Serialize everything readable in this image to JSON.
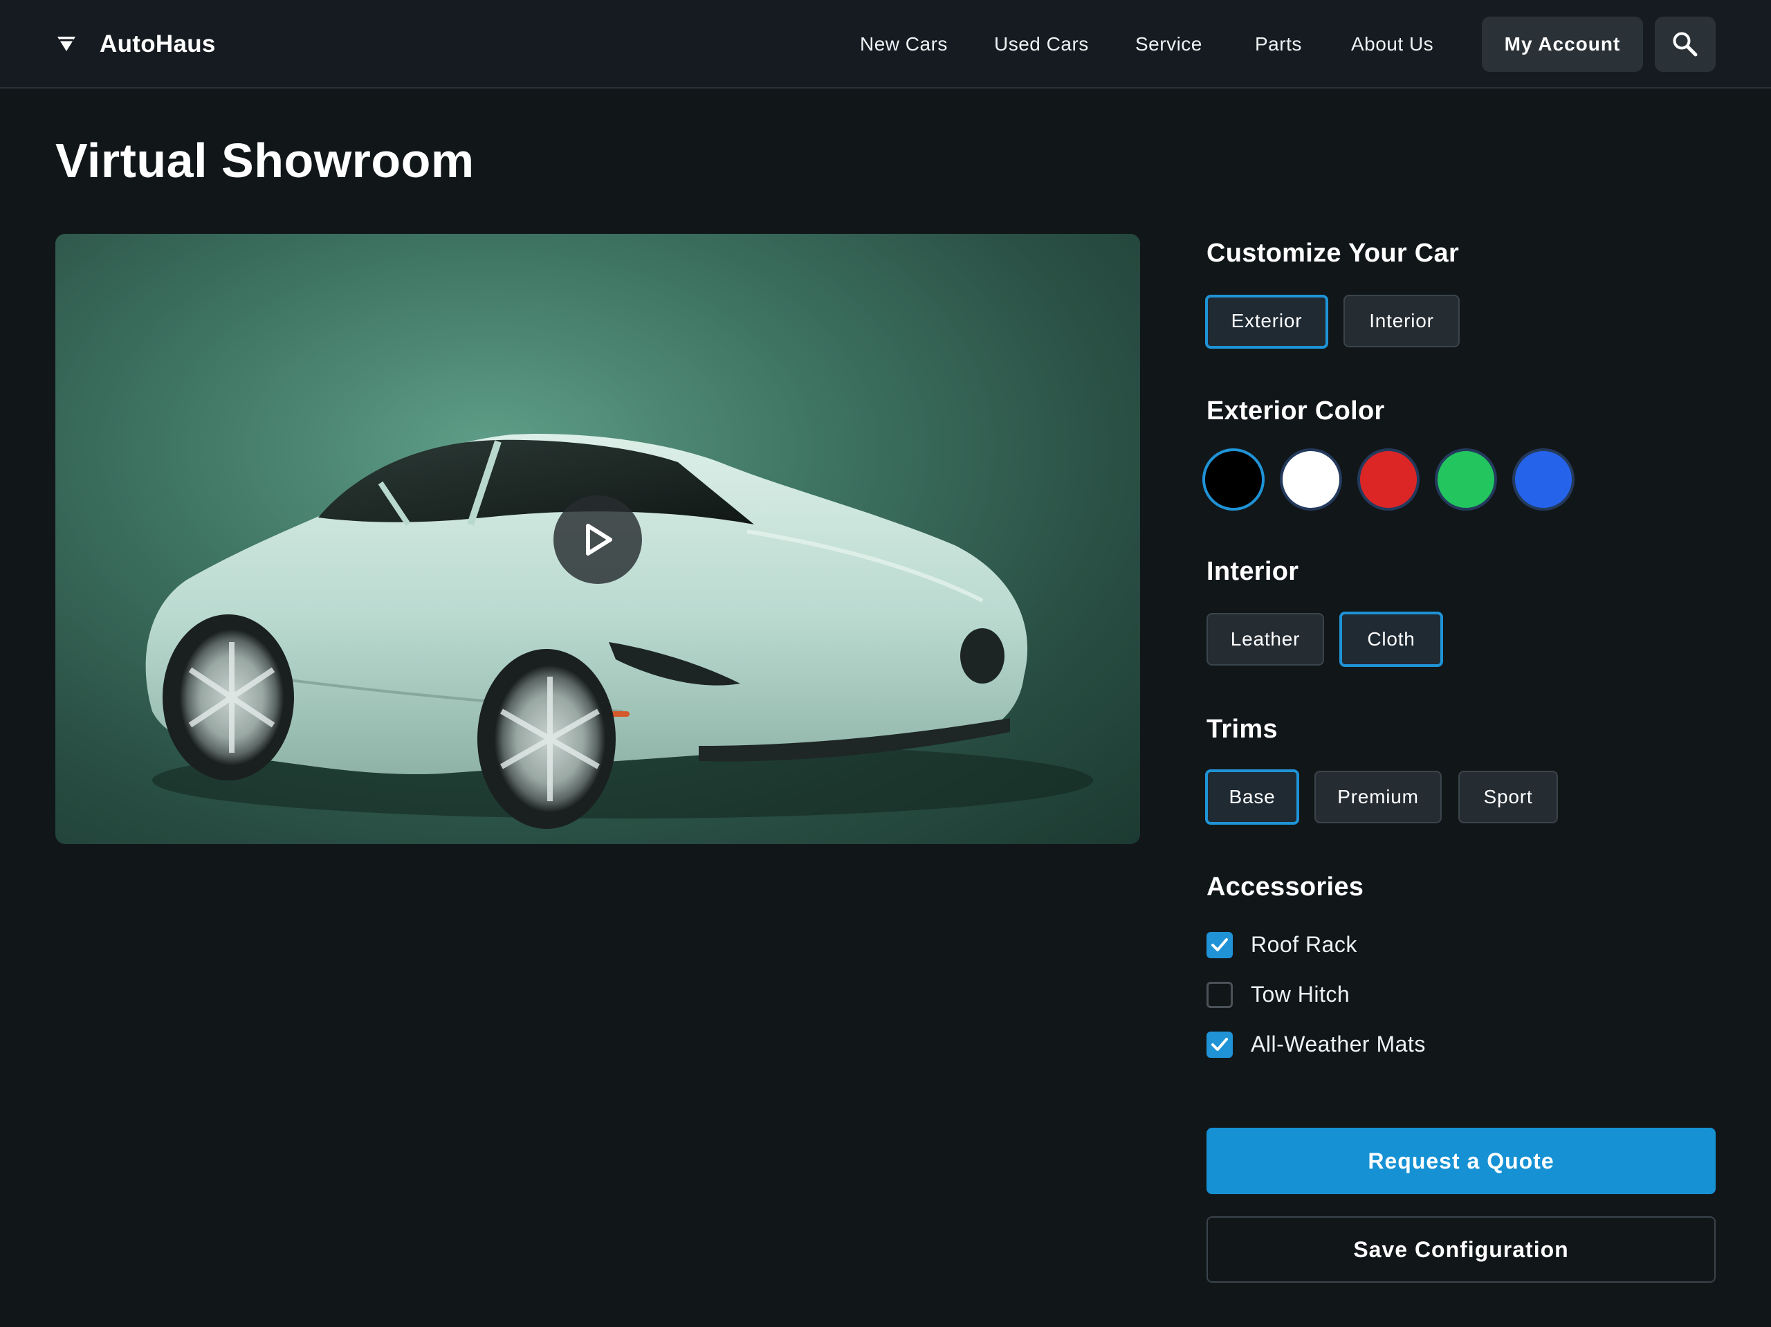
{
  "header": {
    "brand": "AutoHaus",
    "logo_icon": "diamond-cone-icon",
    "nav": [
      "New Cars",
      "Used Cars",
      "Service",
      "Parts",
      "About Us"
    ],
    "account_label": "My Account",
    "search_icon": "search-icon"
  },
  "page_title": "Virtual Showroom",
  "viewer": {
    "play_icon": "play-icon",
    "car_color": "#b9d9cf"
  },
  "customize": {
    "title": "Customize Your Car",
    "tabs": [
      {
        "label": "Exterior",
        "selected": true
      },
      {
        "label": "Interior",
        "selected": false
      }
    ]
  },
  "exterior_color": {
    "title": "Exterior Color",
    "swatches": [
      {
        "name": "black",
        "color": "#000000",
        "selected": true
      },
      {
        "name": "white",
        "color": "#ffffff",
        "selected": false
      },
      {
        "name": "red",
        "color": "#dc2626",
        "selected": false
      },
      {
        "name": "green",
        "color": "#22c55e",
        "selected": false
      },
      {
        "name": "blue",
        "color": "#2563eb",
        "selected": false
      }
    ]
  },
  "interior": {
    "title": "Interior",
    "options": [
      {
        "label": "Leather",
        "selected": false
      },
      {
        "label": "Cloth",
        "selected": true
      }
    ]
  },
  "trims": {
    "title": "Trims",
    "options": [
      {
        "label": "Base",
        "selected": true
      },
      {
        "label": "Premium",
        "selected": false
      },
      {
        "label": "Sport",
        "selected": false
      }
    ]
  },
  "accessories": {
    "title": "Accessories",
    "items": [
      {
        "label": "Roof Rack",
        "checked": true
      },
      {
        "label": "Tow Hitch",
        "checked": false
      },
      {
        "label": "All-Weather Mats",
        "checked": true
      }
    ]
  },
  "actions": {
    "primary": "Request a Quote",
    "secondary": "Save Configuration"
  },
  "colors": {
    "accent": "#1591d4",
    "background": "#111619",
    "surface": "#252d33"
  }
}
